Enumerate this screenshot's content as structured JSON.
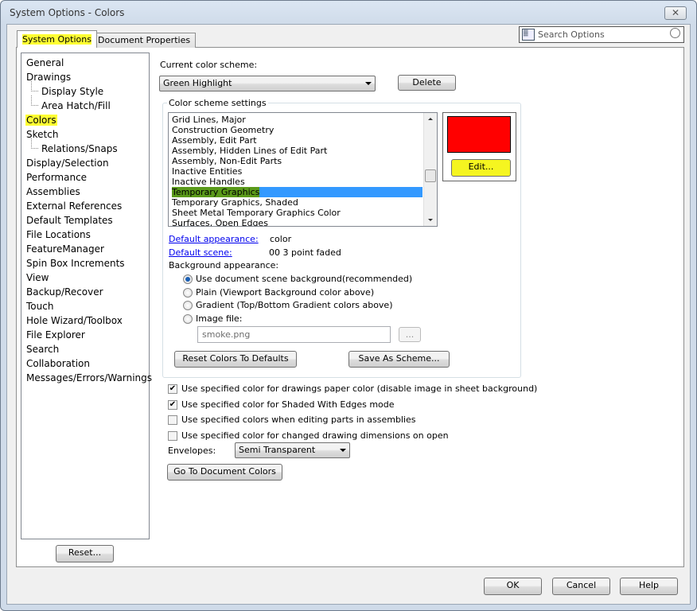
{
  "window": {
    "title": "System Options - Colors",
    "close_glyph": "✕"
  },
  "tabs": [
    {
      "label": "System Options",
      "active": true
    },
    {
      "label": "Document Properties",
      "active": false
    }
  ],
  "search": {
    "placeholder": "Search Options",
    "icon": "magnifier-icon"
  },
  "tree": [
    {
      "label": "General",
      "level": 0
    },
    {
      "label": "Drawings",
      "level": 0
    },
    {
      "label": "Display Style",
      "level": 1
    },
    {
      "label": "Area Hatch/Fill",
      "level": 1
    },
    {
      "label": "Colors",
      "level": 0,
      "selected": true
    },
    {
      "label": "Sketch",
      "level": 0
    },
    {
      "label": "Relations/Snaps",
      "level": 1
    },
    {
      "label": "Display/Selection",
      "level": 0
    },
    {
      "label": "Performance",
      "level": 0
    },
    {
      "label": "Assemblies",
      "level": 0
    },
    {
      "label": "External References",
      "level": 0
    },
    {
      "label": "Default Templates",
      "level": 0
    },
    {
      "label": "File Locations",
      "level": 0
    },
    {
      "label": "FeatureManager",
      "level": 0
    },
    {
      "label": "Spin Box Increments",
      "level": 0
    },
    {
      "label": "View",
      "level": 0
    },
    {
      "label": "Backup/Recover",
      "level": 0
    },
    {
      "label": "Touch",
      "level": 0
    },
    {
      "label": "Hole Wizard/Toolbox",
      "level": 0
    },
    {
      "label": "File Explorer",
      "level": 0
    },
    {
      "label": "Search",
      "level": 0
    },
    {
      "label": "Collaboration",
      "level": 0
    },
    {
      "label": "Messages/Errors/Warnings",
      "level": 0
    }
  ],
  "reset_label": "Reset...",
  "scheme": {
    "label": "Current color scheme:",
    "value": "Green Highlight",
    "delete_label": "Delete"
  },
  "settings": {
    "group_label": "Color scheme settings",
    "items": [
      "Grid Lines, Major",
      "Construction Geometry",
      "Assembly, Edit Part",
      "Assembly, Hidden Lines of Edit Part",
      "Assembly, Non-Edit Parts",
      "Inactive Entities",
      "Inactive Handles",
      "Temporary Graphics",
      "Temporary Graphics, Shaded",
      "Sheet Metal Temporary Graphics Color",
      "Surfaces, Open Edges"
    ],
    "selected": "Temporary Graphics",
    "swatch_color": "#ff0000",
    "edit_label": "Edit...",
    "default_appearance_label": "Default appearance:",
    "default_appearance_value": "color",
    "default_scene_label": "Default scene:",
    "default_scene_value": "00 3 point faded",
    "background_label": "Background appearance:",
    "radios": [
      {
        "label": "Use document scene background(recommended)",
        "checked": true
      },
      {
        "label": "Plain (Viewport Background color above)",
        "checked": false
      },
      {
        "label": "Gradient (Top/Bottom Gradient colors above)",
        "checked": false
      },
      {
        "label": "Image file:",
        "checked": false
      }
    ],
    "image_file": "smoke.png",
    "browse_label": "...",
    "reset_colors_label": "Reset Colors To Defaults",
    "save_scheme_label": "Save As Scheme..."
  },
  "checkboxes": [
    {
      "label": "Use specified color for drawings paper color (disable image in sheet background)",
      "checked": true
    },
    {
      "label": "Use specified color for Shaded With Edges mode",
      "checked": true
    },
    {
      "label": "Use specified colors when editing parts in assemblies",
      "checked": false
    },
    {
      "label": "Use specified color for changed drawing dimensions on open",
      "checked": false
    }
  ],
  "envelopes": {
    "label": "Envelopes:",
    "value": "Semi Transparent"
  },
  "go_doc_colors_label": "Go To Document Colors",
  "footer": {
    "ok": "OK",
    "cancel": "Cancel",
    "help": "Help"
  },
  "colors": {
    "highlight": "#ffff33",
    "selection": "#3399ff",
    "link": "#0000ee"
  }
}
